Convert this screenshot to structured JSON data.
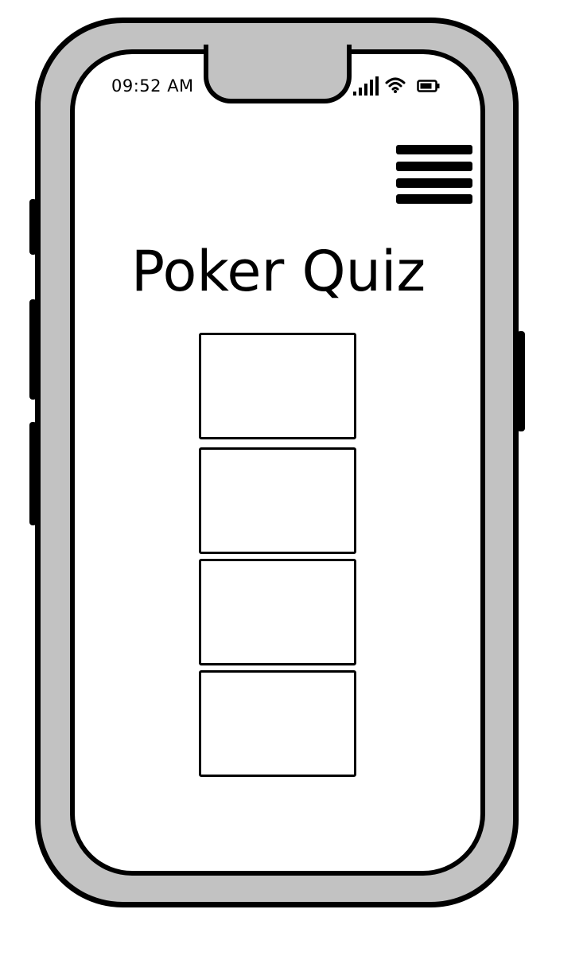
{
  "status_bar": {
    "time": "09:52 AM",
    "icons": [
      "signal-icon",
      "wifi-icon",
      "battery-icon"
    ]
  },
  "header": {
    "menu_icon": "hamburger-menu-icon"
  },
  "main": {
    "title": "Poker Quiz",
    "option_boxes": [
      "",
      "",
      "",
      ""
    ]
  },
  "colors": {
    "frame": "#c2c2c2",
    "outline": "#000000",
    "screen": "#ffffff"
  }
}
